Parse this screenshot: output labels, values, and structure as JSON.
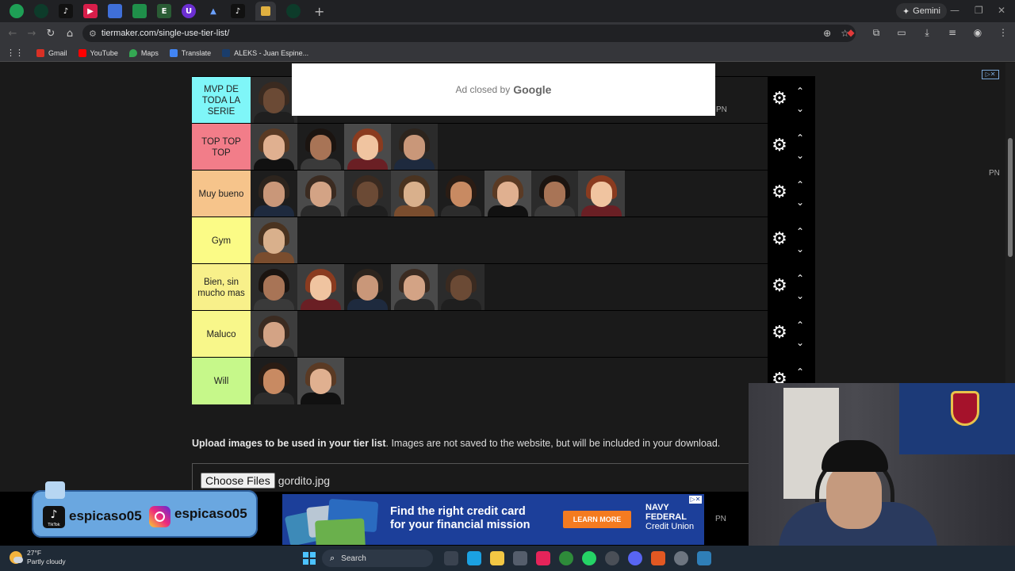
{
  "browser": {
    "gemini_label": "Gemini",
    "url": "tiermaker.com/single-use-tier-list/",
    "bookmarks": [
      "Gmail",
      "YouTube",
      "Maps",
      "Translate",
      "ALEKS - Juan Espine..."
    ]
  },
  "ad_closed": {
    "text": "Ad closed by",
    "brand": "Google"
  },
  "pn_label": "PN",
  "tiers": [
    {
      "label": "MVP DE TODA LA SERIE",
      "color": "#7ff6f8",
      "faces": 1
    },
    {
      "label": "TOP TOP TOP",
      "color": "#f27d89",
      "faces": 4
    },
    {
      "label": "Muy bueno",
      "color": "#f6c48b",
      "faces": 8
    },
    {
      "label": "Gym",
      "color": "#fbfb86",
      "faces": 1
    },
    {
      "label": "Bien, sin mucho mas",
      "color": "#f8f08a",
      "faces": 5
    },
    {
      "label": "Maluco",
      "color": "#f8f78a",
      "faces": 1
    },
    {
      "label": "Will",
      "color": "#c6f88a",
      "faces": 2
    }
  ],
  "upload": {
    "bold": "Upload images to be used in your tier list",
    "rest": ". Images are not saved to the website, but will be included in your download.",
    "button": "Choose Files",
    "filename": "gordito.jpg"
  },
  "bottom_ad": {
    "line1": "Find the right credit card",
    "line2": "for your financial mission",
    "cta": "LEARN MORE",
    "logo1": "NAVY",
    "logo2": "FEDERAL",
    "logo3": "Credit Union"
  },
  "social": {
    "tiktok_handle": "espicaso05",
    "instagram_handle": "espicaso05",
    "tiktok_caption": "TikTok"
  },
  "taskbar": {
    "temp": "27°F",
    "condition": "Partly cloudy",
    "search": "Search"
  }
}
